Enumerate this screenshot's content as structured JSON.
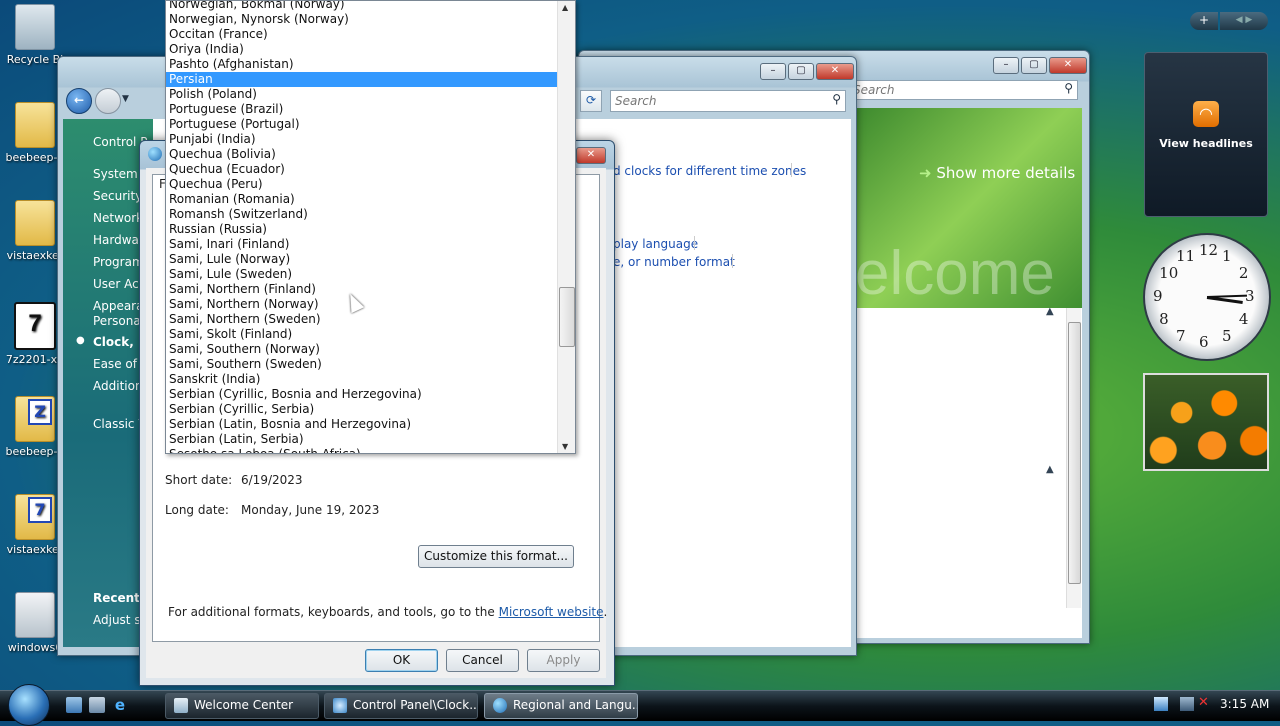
{
  "desktop": {
    "icons": [
      {
        "label": "Recycle Bi"
      },
      {
        "label": "beebeep-5"
      },
      {
        "label": "vistaexker"
      },
      {
        "label": "7z2201-x6"
      },
      {
        "label": "beebeep-5"
      },
      {
        "label": "vistaexker"
      },
      {
        "label": "windows6"
      }
    ]
  },
  "welcome_center": {
    "search_placeholder": "Search",
    "show_more": "Show more details",
    "banner_text": "elcome"
  },
  "control_panel": {
    "search_placeholder": "Search",
    "nav": {
      "home": "Control P",
      "items": [
        "System a",
        "Security",
        "Network",
        "Hardwar",
        "Program",
        "User Acc",
        "Appeara",
        "Personal",
        "Clock, La",
        "Ease of A",
        "Addition",
        "Classic V"
      ],
      "recent_title": "Recent T",
      "recent_item": "Adjust sc"
    },
    "links": {
      "clocks": "d clocks for different time zones",
      "display_language": "play language",
      "number_format": "e, or number format"
    }
  },
  "gadgets": {
    "rss_label": "View headlines",
    "clock_numbers": [
      "12",
      "1",
      "2",
      "3",
      "4",
      "5",
      "6",
      "7",
      "8",
      "9",
      "10",
      "11"
    ]
  },
  "dialog": {
    "tab_stub": "F",
    "short_date_label": "Short date:",
    "short_date_value": "6/19/2023",
    "long_date_label": "Long date:",
    "long_date_value": "Monday, June 19, 2023",
    "customize_button": "Customize this format...",
    "footer_text": "For additional formats, keyboards, and tools, go to the",
    "footer_link": "Microsoft website",
    "footer_end": ".",
    "ok": "OK",
    "cancel": "Cancel",
    "apply": "Apply"
  },
  "dropdown": {
    "selected": "Persian",
    "items": [
      "Norwegian, Bokmål (Norway)",
      "Norwegian, Nynorsk (Norway)",
      "Occitan (France)",
      "Oriya (India)",
      "Pashto (Afghanistan)",
      "Persian",
      "Polish (Poland)",
      "Portuguese (Brazil)",
      "Portuguese (Portugal)",
      "Punjabi (India)",
      "Quechua (Bolivia)",
      "Quechua (Ecuador)",
      "Quechua (Peru)",
      "Romanian (Romania)",
      "Romansh (Switzerland)",
      "Russian (Russia)",
      "Sami, Inari (Finland)",
      "Sami, Lule (Norway)",
      "Sami, Lule (Sweden)",
      "Sami, Northern (Finland)",
      "Sami, Northern (Norway)",
      "Sami, Northern (Sweden)",
      "Sami, Skolt (Finland)",
      "Sami, Southern (Norway)",
      "Sami, Southern (Sweden)",
      "Sanskrit (India)",
      "Serbian (Cyrillic, Bosnia and Herzegovina)",
      "Serbian (Cyrillic, Serbia)",
      "Serbian (Latin, Bosnia and Herzegovina)",
      "Serbian (Latin, Serbia)",
      "Sesotho sa Leboa (South Africa)"
    ]
  },
  "taskbar": {
    "tasks": [
      {
        "label": "Welcome Center"
      },
      {
        "label": "Control Panel\\Clock..."
      },
      {
        "label": "Regional and Langu..."
      }
    ],
    "time": "3:15 AM"
  }
}
